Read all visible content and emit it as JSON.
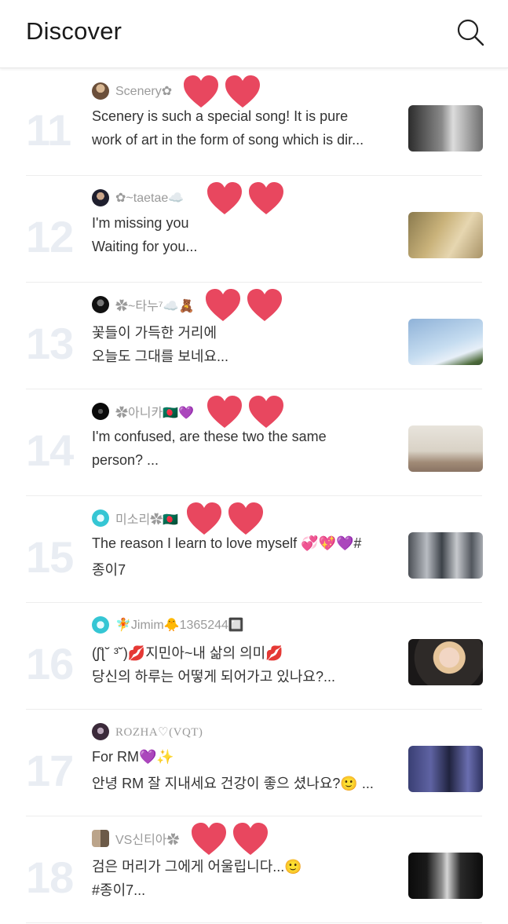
{
  "header": {
    "title": "Discover",
    "search_icon": "search-icon"
  },
  "posts": [
    {
      "rank": "11",
      "username": "Scenery✿",
      "line1": "Scenery is such a special song! It is pure",
      "line2": "work of art in the form of song which is dir...",
      "hearts": 2
    },
    {
      "rank": "12",
      "username": "✿~taetae☁️",
      "line1": "I'm missing you",
      "line2": "Waiting for you...",
      "hearts": 2
    },
    {
      "rank": "13",
      "username": "✿~타누⁷☁️🧸",
      "line1": "꽃들이 가득한 거리에",
      "line2": "오늘도 그대를 보네요...",
      "hearts": 2
    },
    {
      "rank": "14",
      "username": "✿아니카🇧🇩💜",
      "line1": "I'm confused,  are these two the same",
      "line2": "person?  ...",
      "hearts": 2
    },
    {
      "rank": "15",
      "username": "미소리✿🇧🇩",
      "line1": "The reason I learn to love myself 💞💖💜#",
      "line2": "종이7",
      "hearts": 2
    },
    {
      "rank": "16",
      "username": "🧚Jimim🐥1365244🔲",
      "line1": "(ʃƪ˘ ³˘)💋지민아~내 삶의 의미💋",
      "line2": "당신의 하루는 어떻게 되어가고 있나요?...",
      "hearts": 0
    },
    {
      "rank": "17",
      "username": "ROZHA♡(VQT)",
      "line1": "For RM💜✨",
      "line2": "안녕 RM 잘 지내세요 건강이 좋으 셨나요?🙂 ...",
      "hearts": 0
    },
    {
      "rank": "18",
      "username": "VS신티아✿",
      "line1": "검은 머리가 그에게 어울립니다...🙂",
      "line2": "#종이7...",
      "hearts": 2
    }
  ],
  "colors": {
    "heart": "#e8475f",
    "rank": "#e9edf3",
    "username": "#9a9a9a"
  }
}
